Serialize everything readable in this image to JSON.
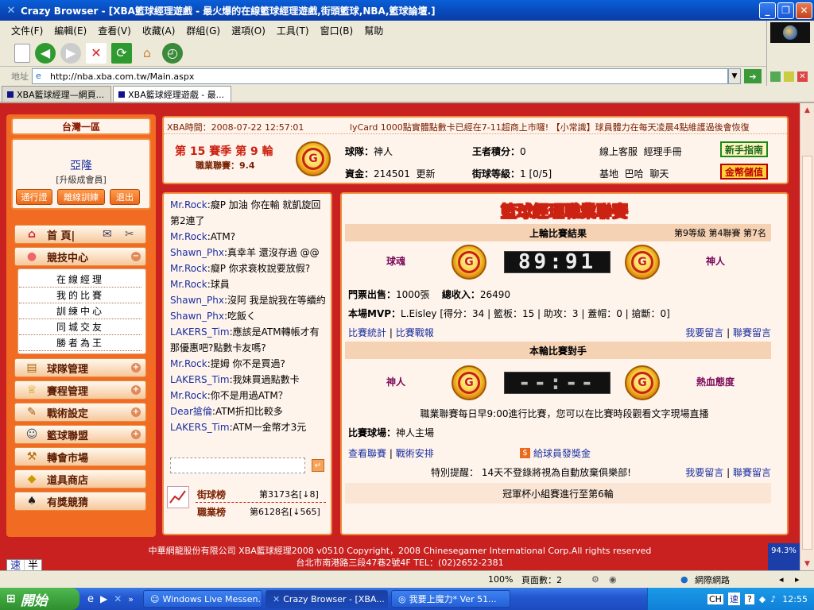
{
  "window": {
    "title": "Crazy Browser - [XBA籃球經理遊戲 - 最火爆的在線籃球經理遊戲,街頭籃球,NBA,籃球論壇.]"
  },
  "menu": [
    "文件(F)",
    "編輯(E)",
    "查看(V)",
    "收藏(A)",
    "群組(G)",
    "選項(O)",
    "工具(T)",
    "窗口(B)",
    "幫助"
  ],
  "address": {
    "label": "地址",
    "url": "http://nba.xba.com.tw/Main.aspx"
  },
  "tabs": [
    {
      "label": "XBA籃球經理—網頁..."
    },
    {
      "label": "XBA籃球經理遊戲 - 最..."
    }
  ],
  "left": {
    "server": "台灣一區",
    "user_name": "亞隆",
    "user_level": "[升級成會員]",
    "buttons": [
      "通行證",
      "離線訓練",
      "退出"
    ],
    "home_label": "首 頁|",
    "nav": [
      {
        "label": "競技中心"
      },
      {
        "label": "球隊管理"
      },
      {
        "label": "賽程管理"
      },
      {
        "label": "戰術設定"
      },
      {
        "label": "籃球聯盟"
      },
      {
        "label": "轉會市場"
      },
      {
        "label": "道具商店"
      },
      {
        "label": "有獎競猜"
      }
    ],
    "sub": [
      "在線經理",
      "我的比賽",
      "訓練中心",
      "同城交友",
      "勝者為王"
    ]
  },
  "info": {
    "time_label": "XBA時間：2008-07-22 12:57:01",
    "marquee": "lyCard 1000點實體點數卡已經在7-11超商上市囉!  【小常識】球員體力在每天凌晨4點維護過後會恢復",
    "season": "第 15 賽季  第 9 輪",
    "league": "職業聯賽：9.4",
    "team_label": "球隊：",
    "team_name": "神人",
    "king_label": "王者積分：",
    "king_value": "0",
    "service": "線上客服",
    "manual": "經理手冊",
    "money_label": "資金：",
    "money_value": "214501",
    "refresh": "更新",
    "grade_label": "街球等級：",
    "grade_value": "1 [0/5]",
    "base": "基地",
    "bar": "巴哈",
    "chat": "聊天",
    "guide_btn": "新手指南",
    "gold_btn": "金幣儲值"
  },
  "chat": [
    {
      "who": "Mr.Rock",
      "text": ":癡P 加油  你在輸  就凱旋回第2連了"
    },
    {
      "who": "Mr.Rock",
      "text": ":ATM?"
    },
    {
      "who": "Shawn_Phx",
      "text": ":真幸羊  還沒存過  @@"
    },
    {
      "who": "Mr.Rock",
      "text": ":癡P 你求衰枚說要放假?"
    },
    {
      "who": "Mr.Rock",
      "text": ":球員"
    },
    {
      "who": "Shawn_Phx",
      "text": ":沒阿  我是說我在等續約"
    },
    {
      "who": "Shawn_Phx",
      "text": ":吃飯く"
    },
    {
      "who": "LAKERS_Tim",
      "text": ":應該是ATM轉帳才有那優惠吧?點數卡友嗎?"
    },
    {
      "who": "Mr.Rock",
      "text": ":提姆  你不是買過?"
    },
    {
      "who": "LAKERS_Tim",
      "text": ":我妹買過點數卡"
    },
    {
      "who": "Mr.Rock",
      "text": ":你不是用過ATM？"
    },
    {
      "who": "Dear搶倫",
      "text": ":ATM折扣比較多"
    },
    {
      "who": "LAKERS_Tim",
      "text": ":ATM一金幣才3元"
    }
  ],
  "rank": {
    "street_label": "街球榜",
    "street_value": "第3173名[↓8]",
    "pro_label": "職業榜",
    "pro_value": "第6128名[↓565]"
  },
  "main": {
    "title": "籃球經理職業聯賽",
    "last_result": "上輪比賽結果",
    "meta": "第9等級  第4聯賽  第7名",
    "home_team": "球魂",
    "away_team": "神人",
    "score": "89:91",
    "ticket_label": "門票出售：",
    "ticket_value": "1000張",
    "income_label": "總收入：",
    "income_value": "26490",
    "mvp_label": "本場MVP：",
    "mvp_value": "L.Eisley [得分：34 | 籃板：15 | 助攻：3 | 蓋帽：0 | 搶斷：0]",
    "stats_link": "比賽統計",
    "report_link": "比賽戰報",
    "msg_link": "我要留言",
    "league_msg_link": "聯賽留言",
    "next_title": "本輪比賽對手",
    "next_home": "神人",
    "next_away": "熱血態度",
    "next_score": "--:--",
    "notice": "職業聯賽每日早9:00進行比賽，您可以在比賽時段觀看文字現場直播",
    "arena_label": "比賽球場：",
    "arena_value": "神人主場",
    "view_link": "查看聯賽",
    "tactic_link": "戰術安排",
    "bonus_link": "給球員發獎金",
    "reminder": "特別提醒：  14天不登錄將視為自動放棄俱樂部!",
    "cup": "冠軍杯小組賽進行至第6輪"
  },
  "footer": {
    "line1": "中華網龍股份有限公司  XBA籃球經理2008 v0510    Copyright，2008 Chinesegamer International Corp.All rights reserved",
    "line2": "台北市南港路三段47巷2號4F TEL：(02)2652-2381",
    "ime1": "速",
    "ime2": "半",
    "percent": "94.3%"
  },
  "status": {
    "zoom": "100%",
    "pages": "頁面數：2",
    "zone": "網際網路"
  },
  "taskbar": {
    "start": "開始",
    "tasks": [
      "Windows Live Messen...",
      "Crazy Browser - [XBA...",
      "我要上魔力* Ver 51..."
    ],
    "clock": "12:55",
    "ime": "CH"
  }
}
